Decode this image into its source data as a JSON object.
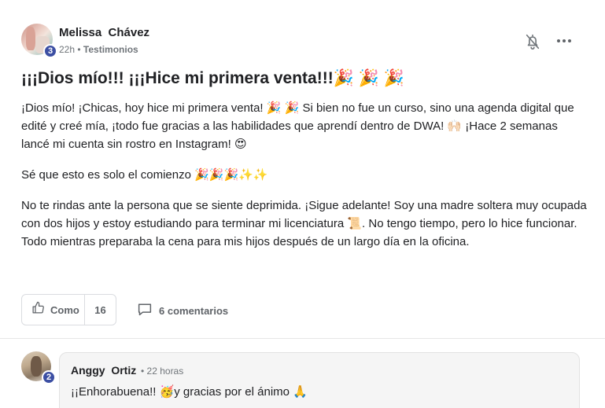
{
  "post": {
    "author": {
      "name": "Melissa  Chávez",
      "level": "3"
    },
    "meta": {
      "time": "22h",
      "separator": " • ",
      "category": "Testimonios"
    },
    "title": "¡¡¡Dios mío!!! ¡¡¡Hice mi primera venta!!!🎉 🎉 🎉",
    "paragraphs": [
      "¡Dios mío! ¡Chicas, hoy hice mi primera venta! 🎉 🎉 Si bien no fue un curso, sino una agenda digital que edité y creé mía, ¡todo fue gracias a las habilidades que aprendí dentro de DWA! 🙌🏻 ¡Hace 2 semanas lancé mi cuenta sin rostro en Instagram! 😍",
      "Sé que esto es solo el comienzo 🎉🎉🎉✨✨",
      "No te rindas ante la persona que se siente deprimida. ¡Sigue adelante! Soy una madre soltera muy ocupada con dos hijos y estoy estudiando para terminar mi licenciatura 📜. No tengo tiempo, pero lo hice funcionar. Todo mientras preparaba la cena para mis hijos después de un largo día en la oficina."
    ],
    "actions": {
      "like_label": "Como",
      "like_count": "16",
      "comments_label": "6 comentarios"
    },
    "icons": {
      "bell": "bell-off-icon",
      "more": "more-horizontal-icon",
      "like": "thumbs-up-icon",
      "comment": "comment-icon"
    }
  },
  "comment": {
    "author": {
      "name": "Anggy  Ortiz",
      "level": "2"
    },
    "time": "• 22 horas",
    "text": "¡¡Enhorabuena!! 🥳y gracias por el ánimo 🙏"
  },
  "colors": {
    "badge": "#3c4fa3",
    "text": "#202124",
    "muted": "#70757a",
    "border": "#dadce0",
    "comment_bg": "#f5f5f5"
  }
}
